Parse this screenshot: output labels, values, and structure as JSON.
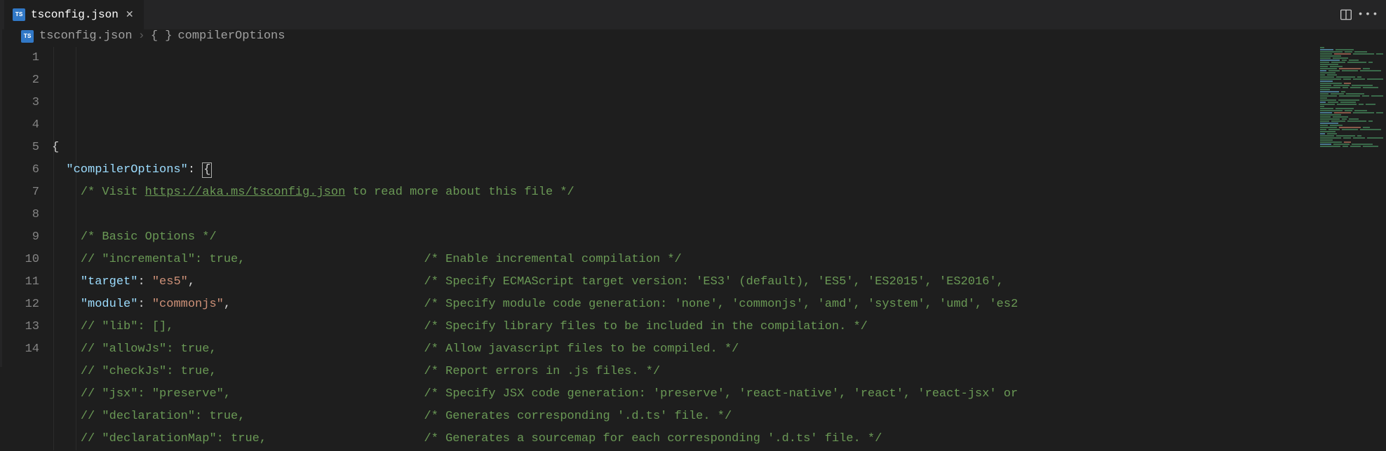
{
  "tabs": {
    "active": {
      "icon_text": "TS",
      "label": "tsconfig.json"
    }
  },
  "breadcrumb": {
    "file_icon_text": "TS",
    "file": "tsconfig.json",
    "symbol_braces": "{ }",
    "symbol": "compilerOptions"
  },
  "gutter_numbers": [
    "1",
    "2",
    "3",
    "4",
    "5",
    "6",
    "7",
    "8",
    "9",
    "10",
    "11",
    "12",
    "13",
    "14"
  ],
  "code": {
    "l1_open": "{",
    "l2_key": "\"compilerOptions\"",
    "l2_colon": ": ",
    "l2_brace": "{",
    "l3_prefix": "/* Visit ",
    "l3_link": "https://aka.ms/tsconfig.json",
    "l3_suffix": " to read more about this file */",
    "l5": "/* Basic Options */",
    "l6_left": "// \"incremental\": true,",
    "l6_right": "/* Enable incremental compilation */",
    "l7_key": "\"target\"",
    "l7_colon": ": ",
    "l7_val": "\"es5\"",
    "l7_comma": ",",
    "l7_right": "/* Specify ECMAScript target version: 'ES3' (default), 'ES5', 'ES2015', 'ES2016',",
    "l8_key": "\"module\"",
    "l8_colon": ": ",
    "l8_val": "\"commonjs\"",
    "l8_comma": ",",
    "l8_right": "/* Specify module code generation: 'none', 'commonjs', 'amd', 'system', 'umd', 'es2",
    "l9_left": "// \"lib\": [],",
    "l9_right": "/* Specify library files to be included in the compilation. */",
    "l10_left": "// \"allowJs\": true,",
    "l10_right": "/* Allow javascript files to be compiled. */",
    "l11_left": "// \"checkJs\": true,",
    "l11_right": "/* Report errors in .js files. */",
    "l12_left": "// \"jsx\": \"preserve\",",
    "l12_right": "/* Specify JSX code generation: 'preserve', 'react-native', 'react', 'react-jsx' or",
    "l13_left": "// \"declaration\": true,",
    "l13_right": "/* Generates corresponding '.d.ts' file. */",
    "l14_left": "// \"declarationMap\": true,",
    "l14_right": "/* Generates a sourcemap for each corresponding '.d.ts' file. */"
  },
  "col_left_chars": 52
}
